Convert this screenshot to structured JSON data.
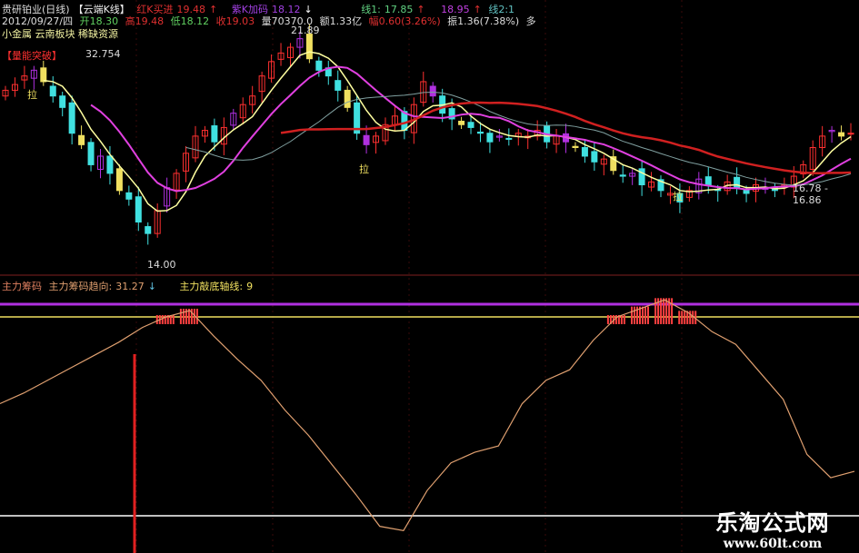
{
  "header": {
    "title": "贵研铂业(日线)",
    "formula": "【云端K线】",
    "red_k_label": "红K买进",
    "red_k_value": "19.48",
    "purple_k_label": "紫K加码",
    "purple_k_value": "18.12",
    "line1_label": "线1:",
    "line1_value": "17.85",
    "line_value2": "18.95",
    "line2_label": "线2:1",
    "date": "2012/09/27/四",
    "open": "开18.30",
    "high": "高19.48",
    "low": "低18.12",
    "close": "收19.03",
    "volume": "量70370.0",
    "amount": "额1.33亿",
    "change": "幅0.60(3.26%)",
    "amplitude": "振1.36(7.38%)",
    "amp_suffix": "多"
  },
  "tags": "小金属 云南板块 稀缺资源",
  "badge": "【量能突破】",
  "badge_value": "32.754",
  "price_labels": {
    "high": "21.89",
    "low": "14.00",
    "range": "16.78 - 16.86",
    "pull": "拉"
  },
  "indicator_header": {
    "name": "主力筹码",
    "trend_label": "主力筹码趋向:",
    "trend_value": "31.27",
    "bottom_label": "主力敲底轴线:",
    "bottom_value": "9"
  },
  "watermark": {
    "name": "乐淘公式网",
    "url": "www.60lt.com"
  },
  "colors": {
    "up": "#ff3030",
    "down": "#40e0e0",
    "purple": "#b030e0",
    "yellow": "#f0e060",
    "ma_red": "#d02020",
    "indicator": "#e0a070",
    "bg": "#000000"
  },
  "chart_data": [
    {
      "type": "candlestick",
      "title": "贵研铂业(日线)",
      "closes": [
        19.8,
        20.0,
        20.3,
        20.5,
        20.1,
        19.6,
        19.2,
        18.3,
        17.9,
        17.2,
        17.5,
        16.9,
        16.3,
        16.0,
        15.2,
        14.8,
        15.6,
        16.4,
        16.9,
        17.6,
        18.2,
        18.4,
        18.0,
        18.5,
        19.0,
        19.3,
        19.6,
        20.3,
        20.8,
        21.1,
        21.3,
        21.6,
        20.9,
        20.5,
        20.3,
        19.8,
        19.2,
        18.3,
        17.9,
        18.2,
        18.6,
        18.9,
        18.4,
        19.3,
        20.1,
        19.6,
        19.0,
        18.8,
        18.6,
        18.5,
        18.3,
        18.0,
        18.2,
        18.1,
        18.3,
        18.2,
        18.4,
        18.0,
        18.2,
        18.0,
        17.8,
        17.5,
        17.3,
        17.4,
        17.0,
        16.8,
        16.9,
        16.5,
        16.6,
        16.3,
        16.2,
        15.9,
        16.3,
        16.7,
        16.5,
        16.3,
        16.6,
        16.4,
        16.2,
        16.5,
        16.4,
        16.3,
        16.5,
        16.8,
        17.2,
        17.8,
        18.2,
        18.4,
        18.2,
        18.3
      ],
      "ylim": [
        13.6,
        22.0
      ],
      "annotations": [
        "21.89",
        "14.00",
        "16.78 - 16.86"
      ]
    },
    {
      "type": "line",
      "title": "主力筹码",
      "values": [
        53,
        58,
        64,
        70,
        76,
        82,
        89,
        94,
        97,
        85,
        74,
        64,
        50,
        38,
        24,
        10,
        -5,
        -7,
        12,
        25,
        30,
        33,
        53,
        64,
        69,
        83,
        94,
        98,
        102,
        96,
        87,
        81,
        68,
        55,
        29,
        18,
        21
      ],
      "reference_lines": [
        100,
        94,
        0
      ],
      "ylim": [
        -10,
        105
      ]
    }
  ]
}
